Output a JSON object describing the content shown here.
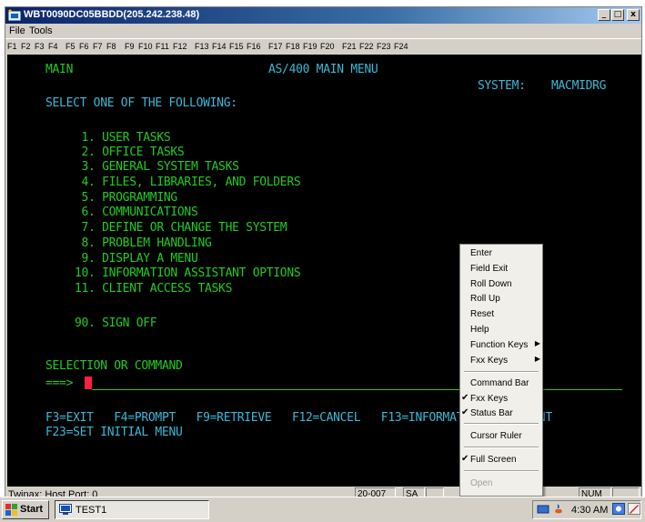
{
  "window": {
    "title": "WBT0090DC05BBDD(205.242.238.48)",
    "minimize_glyph": "_",
    "maximize_glyph": "□",
    "close_glyph": "x"
  },
  "menubar": {
    "items": [
      "File",
      "Tools"
    ]
  },
  "fkeys": [
    "F1",
    "F2",
    "F3",
    "F4",
    "F5",
    "F6",
    "F7",
    "F8",
    "F9",
    "F10",
    "F11",
    "F12",
    "F13",
    "F14",
    "F15",
    "F16",
    "F17",
    "F18",
    "F19",
    "F20",
    "F21",
    "F22",
    "F23",
    "F24"
  ],
  "terminal": {
    "screen_id": "MAIN",
    "menu_title": "AS/400 MAIN MENU",
    "system_label": "SYSTEM:",
    "system_name": "MACMIDRG",
    "instruction": "SELECT ONE OF THE FOLLOWING:",
    "options": [
      " 1. USER TASKS",
      " 2. OFFICE TASKS",
      " 3. GENERAL SYSTEM TASKS",
      " 4. FILES, LIBRARIES, AND FOLDERS",
      " 5. PROGRAMMING",
      " 6. COMMUNICATIONS",
      " 7. DEFINE OR CHANGE THE SYSTEM",
      " 8. PROBLEM HANDLING",
      " 9. DISPLAY A MENU",
      "10. INFORMATION ASSISTANT OPTIONS",
      "11. CLIENT ACCESS TASKS"
    ],
    "signoff_option": "90. SIGN OFF",
    "prompt_label": "SELECTION OR COMMAND",
    "prompt_arrow": "===>",
    "command_value": "",
    "fkeys_line1": "F3=EXIT   F4=PROMPT   F9=RETRIEVE   F12=CANCEL   F13=INFORMATION ASSISTANT",
    "fkeys_line2": "F23=SET INITIAL MENU"
  },
  "context_menu": {
    "items": [
      {
        "label": "Enter"
      },
      {
        "label": "Field Exit"
      },
      {
        "label": "Roll Down"
      },
      {
        "label": "Roll Up"
      },
      {
        "label": "Reset"
      },
      {
        "label": "Help"
      },
      {
        "label": "Function Keys",
        "submenu": true
      },
      {
        "label": "Fxx Keys",
        "submenu": true
      },
      {
        "label": "Command Bar"
      },
      {
        "label": "Fxx Keys",
        "checked": true
      },
      {
        "label": "Status Bar",
        "checked": true
      },
      {
        "label": "Cursor Ruler"
      },
      {
        "label": "Full Screen",
        "checked": true
      },
      {
        "label": "Open",
        "disabled": true
      }
    ],
    "check_glyph": "✔",
    "arrow_glyph": "▶"
  },
  "statusbar": {
    "text": "Twinax: Host Port: 0",
    "cells": [
      "20-007",
      "SA",
      "NUM"
    ]
  },
  "taskbar": {
    "start_label": "Start",
    "task_label": "TEST1",
    "clock": "4:30 AM"
  },
  "colors": {
    "terminal_green": "#22cc22",
    "terminal_cyan": "#3cb8d8",
    "cursor": "#ff2040",
    "title_bar": "#0a246a"
  }
}
